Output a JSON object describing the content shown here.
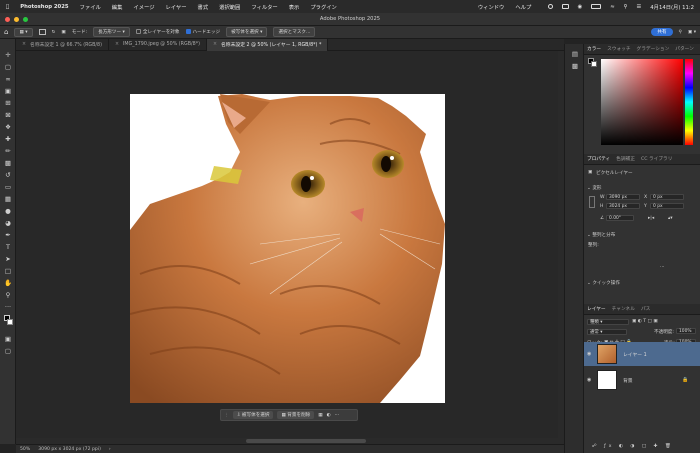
{
  "menubar": {
    "app": "Photoshop 2025",
    "items": [
      "ファイル",
      "編集",
      "イメージ",
      "レイヤー",
      "書式",
      "選択範囲",
      "フィルター",
      "表示",
      "プラグイン",
      "ウィンドウ",
      "ヘルプ"
    ],
    "datetime": "4月14日(月) 11:2"
  },
  "window": {
    "title": "Adobe Photoshop 2025",
    "share_label": "共有"
  },
  "options": {
    "mode_label": "モード:",
    "mode_value": "長方形ツー",
    "all_layers": "全レイヤーを対象",
    "hard_edge": "ハードエッジ",
    "select_subject": "被写体を選択",
    "select_mask": "選択とマスク..."
  },
  "tabs": [
    "名称未設定 1 @ 66.7% (RGB/8)",
    "IMG_1790.jpeg @ 50% (RGB/8*)",
    "名称未設定 2 @ 50% (レイヤー 1, RGB/8*) *"
  ],
  "context": {
    "select_subject": "被写体を選択",
    "remove_bg": "背景を削除",
    "more": "···"
  },
  "status": {
    "zoom": "50%",
    "dims": "3090 px x 3024 px (72 ppi)"
  },
  "color_panel": {
    "tabs": [
      "カラー",
      "スウォッチ",
      "グラデーション",
      "パターン"
    ]
  },
  "props_panel": {
    "tabs": [
      "プロパティ",
      "色調補正",
      "CC ライブラリ"
    ],
    "type": "ピクセルレイヤー",
    "transform": "変形",
    "w_label": "W",
    "w_value": "3090 px",
    "h_label": "H",
    "h_value": "3024 px",
    "x_label": "X",
    "x_value": "0 px",
    "y_label": "Y",
    "y_value": "0 px",
    "angle": "0.00°",
    "align": "整列と分布",
    "align_sub": "整列:",
    "quick": "クイック操作",
    "more": "···"
  },
  "layers_panel": {
    "tabs": [
      "レイヤー",
      "チャンネル",
      "パス"
    ],
    "kind": "種類",
    "blend": "通常",
    "opacity_label": "不透明度:",
    "opacity": "100%",
    "lock_label": "ロック:",
    "fill_label": "塗り:",
    "fill": "100%",
    "layers": [
      {
        "name": "レイヤー 1"
      },
      {
        "name": "背景"
      }
    ]
  },
  "colors": {
    "accent": "#2f6fd6",
    "selected_layer": "#4d6a8f",
    "panel": "#323232"
  }
}
